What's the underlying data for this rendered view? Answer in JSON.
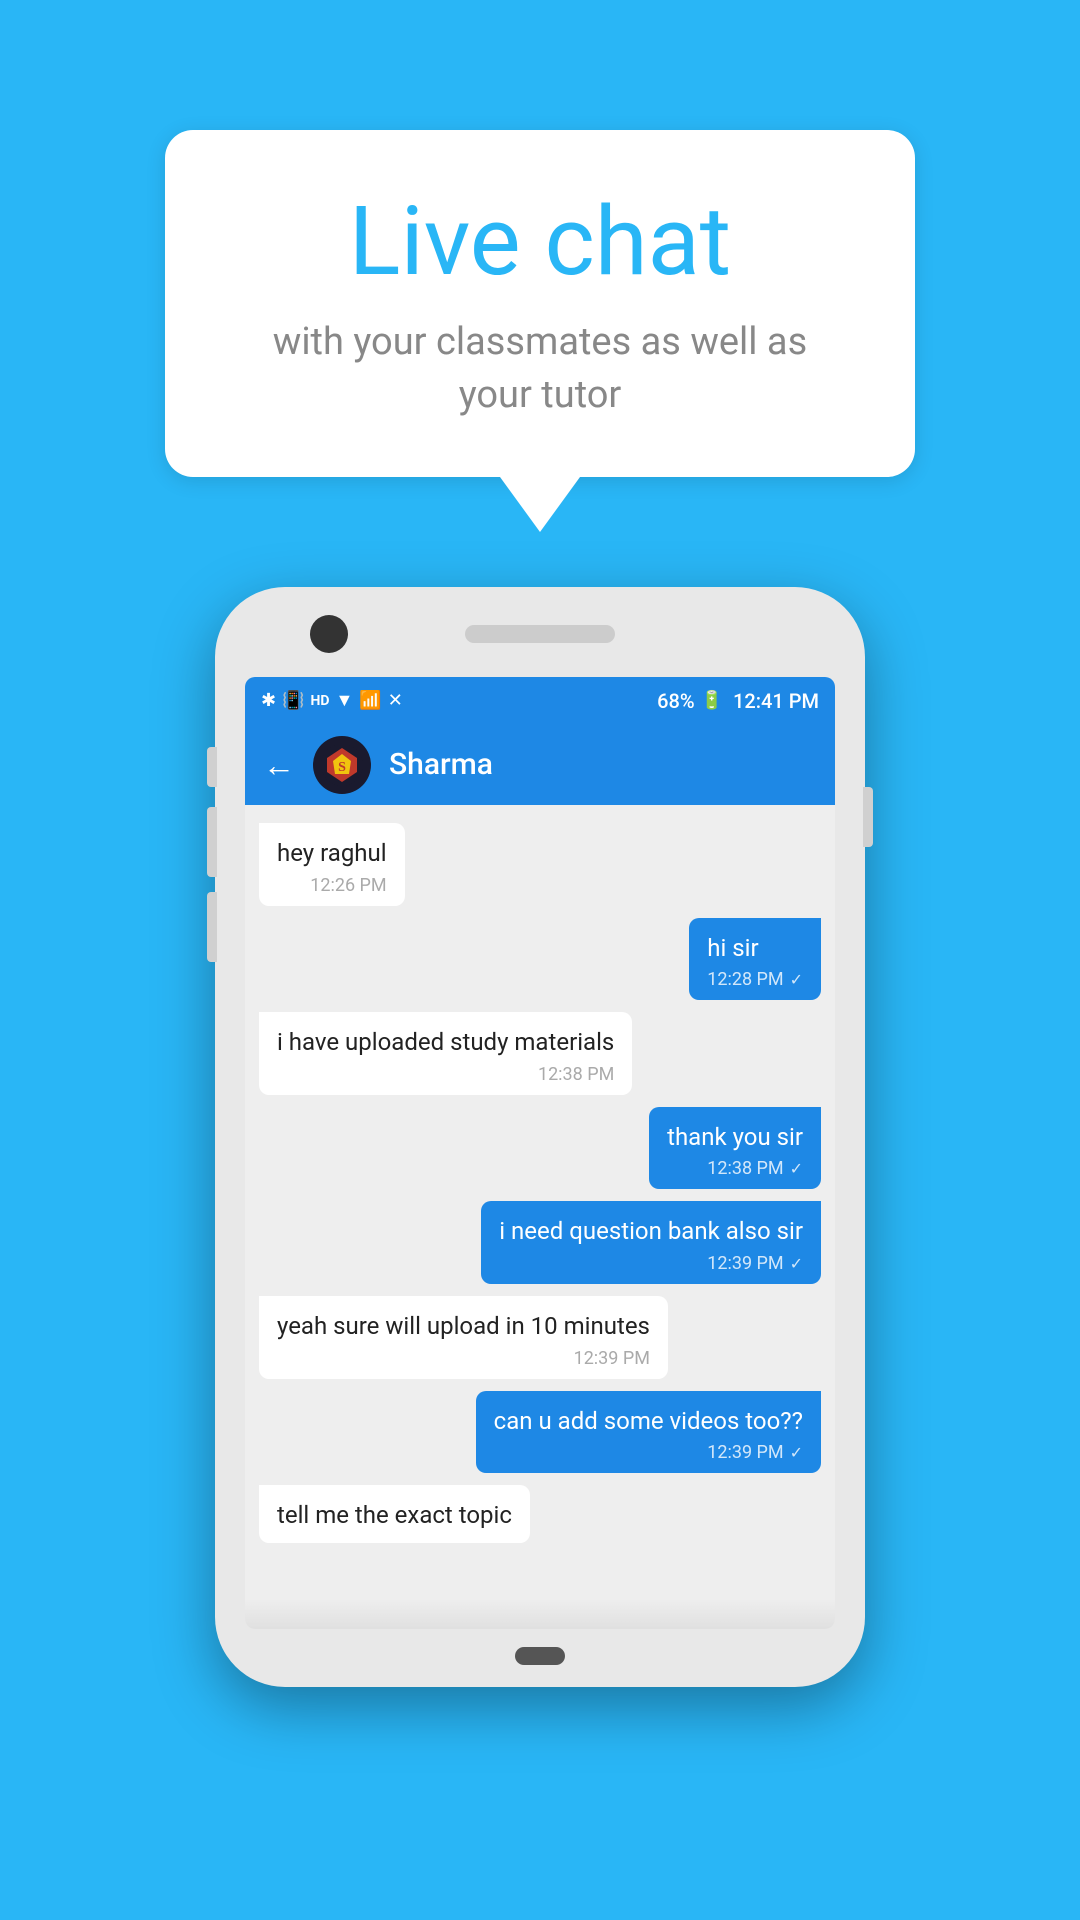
{
  "page": {
    "background_color": "#29b6f6"
  },
  "speech_bubble": {
    "title": "Live chat",
    "subtitle": "with your classmates as well as your tutor"
  },
  "status_bar": {
    "time": "12:41 PM",
    "battery": "68%",
    "icons": [
      "bluetooth",
      "vibrate",
      "hd",
      "wifi",
      "signal",
      "mute",
      "battery"
    ]
  },
  "chat_header": {
    "back_label": "←",
    "contact_name": "Sharma",
    "avatar_emoji": "🦸"
  },
  "messages": [
    {
      "id": 1,
      "type": "received",
      "text": "hey raghul",
      "time": "12:26 PM",
      "check": ""
    },
    {
      "id": 2,
      "type": "sent",
      "text": "hi sir",
      "time": "12:28 PM",
      "check": "✓"
    },
    {
      "id": 3,
      "type": "received",
      "text": "i have uploaded study materials",
      "time": "12:38 PM",
      "check": ""
    },
    {
      "id": 4,
      "type": "sent",
      "text": "thank you sir",
      "time": "12:38 PM",
      "check": "✓"
    },
    {
      "id": 5,
      "type": "sent",
      "text": "i need question bank also sir",
      "time": "12:39 PM",
      "check": "✓"
    },
    {
      "id": 6,
      "type": "received",
      "text": "yeah sure will upload in 10 minutes",
      "time": "12:39 PM",
      "check": ""
    },
    {
      "id": 7,
      "type": "sent",
      "text": "can u add some videos too??",
      "time": "12:39 PM",
      "check": "✓"
    },
    {
      "id": 8,
      "type": "received",
      "text": "tell me the exact topic",
      "time": "",
      "check": "",
      "partial": true
    }
  ]
}
